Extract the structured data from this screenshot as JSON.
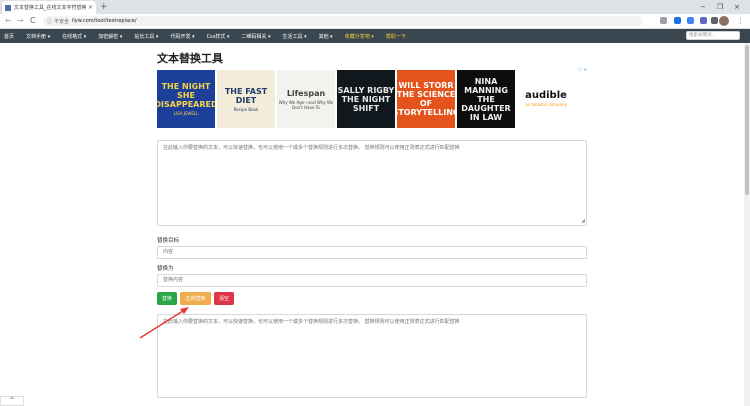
{
  "browser": {
    "tab_title": "文本替换工具_在线文本字符替换 - ...",
    "tab_close": "×",
    "new_tab": "+",
    "back": "←",
    "forward": "→",
    "reload": "C",
    "insecure_label": "不安全",
    "url": "ilyw.com/tool/textreplace/",
    "window_minimize": "−",
    "window_restore": "❐",
    "window_close": "×",
    "menu_icon": "⋮"
  },
  "site_nav": {
    "items": [
      {
        "label": "首页",
        "highlight": false
      },
      {
        "label": "文档手册 ▾",
        "highlight": false
      },
      {
        "label": "在线格式 ▾",
        "highlight": false
      },
      {
        "label": "加密解密 ▾",
        "highlight": false
      },
      {
        "label": "站长工具 ▾",
        "highlight": false
      },
      {
        "label": "代码开发 ▾",
        "highlight": false
      },
      {
        "label": "Css样式 ▾",
        "highlight": false
      },
      {
        "label": "二维码相关 ▾",
        "highlight": false
      },
      {
        "label": "生活工具 ▾",
        "highlight": false
      },
      {
        "label": "其他 ▾",
        "highlight": false
      },
      {
        "label": "收藏分享吧 ▾",
        "highlight": true
      },
      {
        "label": "帮助一下",
        "highlight": true
      }
    ],
    "search_placeholder": "搜索关键词..."
  },
  "page": {
    "title": "文本替换工具",
    "ad_label": "ⓘ ✕",
    "books": [
      {
        "line1": "THE NIGHT SHE DISAPPEARED",
        "line2": "LISA JEWELL"
      },
      {
        "line1": "THE FAST DIET",
        "line2": "Recipe Book"
      },
      {
        "line1": "Lifespan",
        "line2": "Why We Age—and Why We Don't Have To"
      },
      {
        "line1": "SALLY RIGBY THE NIGHT SHIFT",
        "line2": ""
      },
      {
        "line1": "WILL STORR THE SCIENCE OF STORYTELLING",
        "line2": ""
      },
      {
        "line1": "NINA MANNING THE DAUGHTER IN LAW",
        "line2": ""
      },
      {
        "line1": "audible",
        "line2": "an amazon company"
      }
    ],
    "source_placeholder": "在此输入你要替换的文本，可以快速替换，也可以使用一个或多个替换规则进行多次替换。 替换规则可以使用正则表达式进行匹配替换",
    "find_label": "替换目标",
    "find_value": "内容",
    "replace_label": "替换为",
    "replace_value": "替换内容",
    "btn_replace": "替换",
    "btn_regex": "正则替换",
    "btn_clear": "清空",
    "result_placeholder": "在此输入你要替换的文本，可以快速替换，也可以使用一个或多个替换规则进行多次替换。 替换规则可以使用正则表达式进行匹配替换",
    "resize_glyph": "◢",
    "corner_label": "^"
  },
  "colors": {
    "nav_bg": "#3a4750",
    "btn_replace": "#28a745",
    "btn_regex": "#f0ad4e",
    "btn_clear": "#dc3545",
    "arrow": "#e53935"
  }
}
